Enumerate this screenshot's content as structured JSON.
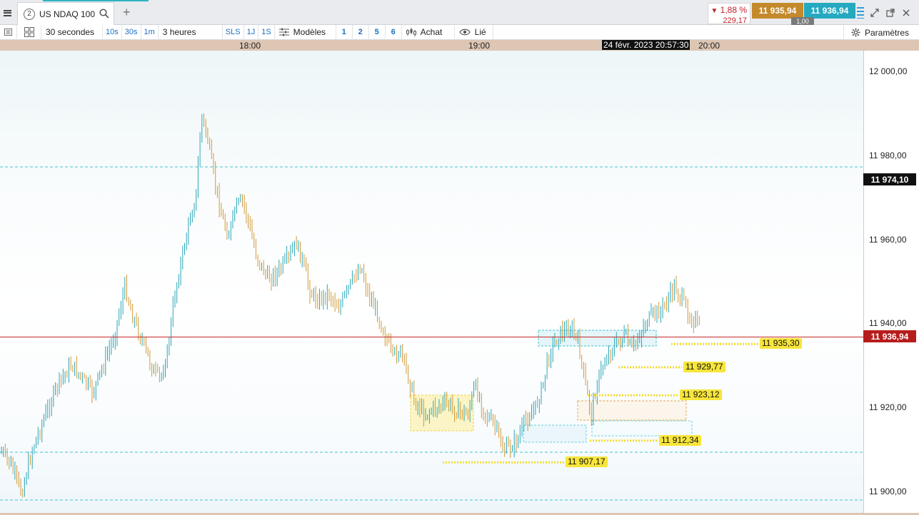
{
  "tab": {
    "badge": "2",
    "symbol": "US NDAQ 100",
    "add": "+"
  },
  "quote": {
    "change_pct": "1,88 %",
    "change_arrow": "▼",
    "change_abs": "229,17",
    "sell_price": "11 935,94",
    "buy_price": "11 936,94",
    "quantity": "1,00"
  },
  "toolbar": {
    "interval": "30 secondes",
    "tf_10s": "10s",
    "tf_30s": "30s",
    "tf_1m": "1m",
    "range": "3 heures",
    "sls": "SLS",
    "r_1j": "1J",
    "r_1s": "1S",
    "models": "Modèles",
    "n1": "1",
    "n2": "2",
    "n5": "5",
    "n6": "6",
    "buy": "Achat",
    "linked": "Lié",
    "settings": "Paramètres"
  },
  "time_axis": {
    "labels": [
      "18:00",
      "19:00",
      "20:00"
    ],
    "cursor": "24 févr. 2023 20:57:30"
  },
  "price_axis": {
    "labels": [
      "12 000,00",
      "11 980,00",
      "11 960,00",
      "11 940,00",
      "11 920,00",
      "11 900,00"
    ],
    "current": "11 936,94",
    "cursor": "11 974,10"
  },
  "levels": [
    "11 935,30",
    "11 929,77",
    "11 923,12",
    "11 912,34",
    "11 907,17"
  ],
  "colors": {
    "up": "#2aa6b8",
    "down": "#d19a3a",
    "current_line": "#c62828",
    "level": "#f2dc2f",
    "axis_band": "#ddc6b4"
  },
  "icons": [
    "menu-icon",
    "search-icon",
    "layout-icon",
    "grid-icon",
    "templates-icon",
    "buy-icon",
    "eye-icon",
    "gear-icon",
    "expand-icon",
    "popout-icon",
    "close-icon"
  ]
}
